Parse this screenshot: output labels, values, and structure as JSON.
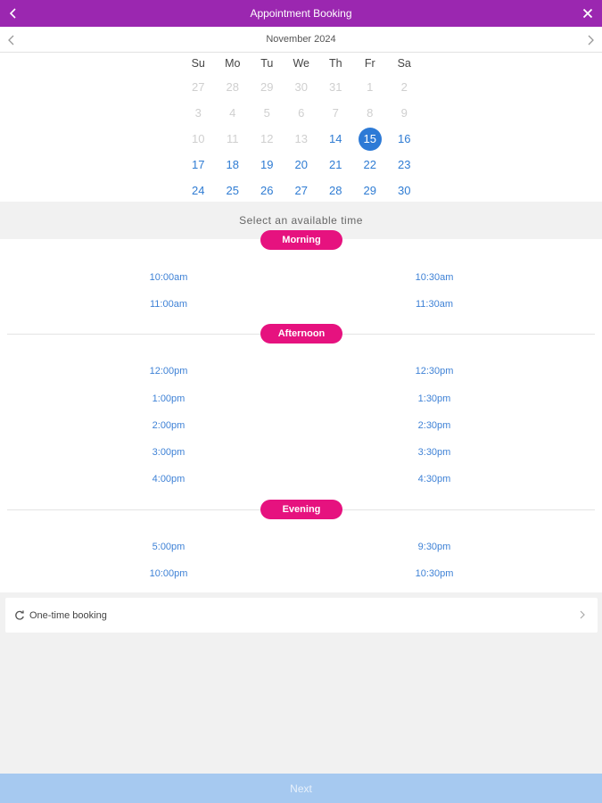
{
  "header": {
    "title": "Appointment Booking",
    "back_icon": "chevron-left-icon",
    "close_icon": "close-icon",
    "color": "#9b27b0"
  },
  "calendar": {
    "month_label": "November 2024",
    "prev_icon": "chevron-left-icon",
    "next_icon": "chevron-right-icon",
    "weekdays": [
      "Su",
      "Mo",
      "Tu",
      "We",
      "Th",
      "Fr",
      "Sa"
    ],
    "weeks": [
      [
        {
          "d": "27",
          "s": "dim"
        },
        {
          "d": "28",
          "s": "dim"
        },
        {
          "d": "29",
          "s": "dim"
        },
        {
          "d": "30",
          "s": "dim"
        },
        {
          "d": "31",
          "s": "dim"
        },
        {
          "d": "1",
          "s": "dim"
        },
        {
          "d": "2",
          "s": "dim"
        }
      ],
      [
        {
          "d": "3",
          "s": "dim"
        },
        {
          "d": "4",
          "s": "dim"
        },
        {
          "d": "5",
          "s": "dim"
        },
        {
          "d": "6",
          "s": "dim"
        },
        {
          "d": "7",
          "s": "dim"
        },
        {
          "d": "8",
          "s": "dim"
        },
        {
          "d": "9",
          "s": "dim"
        }
      ],
      [
        {
          "d": "10",
          "s": "dim"
        },
        {
          "d": "11",
          "s": "dim"
        },
        {
          "d": "12",
          "s": "dim"
        },
        {
          "d": "13",
          "s": "dim"
        },
        {
          "d": "14",
          "s": "avail"
        },
        {
          "d": "15",
          "s": "sel"
        },
        {
          "d": "16",
          "s": "avail"
        }
      ],
      [
        {
          "d": "17",
          "s": "avail"
        },
        {
          "d": "18",
          "s": "avail"
        },
        {
          "d": "19",
          "s": "avail"
        },
        {
          "d": "20",
          "s": "avail"
        },
        {
          "d": "21",
          "s": "avail"
        },
        {
          "d": "22",
          "s": "avail"
        },
        {
          "d": "23",
          "s": "avail"
        }
      ],
      [
        {
          "d": "24",
          "s": "avail"
        },
        {
          "d": "25",
          "s": "avail"
        },
        {
          "d": "26",
          "s": "avail"
        },
        {
          "d": "27",
          "s": "avail"
        },
        {
          "d": "28",
          "s": "avail"
        },
        {
          "d": "29",
          "s": "avail"
        },
        {
          "d": "30",
          "s": "avail"
        }
      ]
    ],
    "selected_color": "#2d7ad6",
    "available_color": "#2f7cd3"
  },
  "time_select": {
    "prompt": "Select an available time",
    "pill_color": "#e6127f",
    "morning": {
      "label": "Morning",
      "left": [
        "10:00am",
        "11:00am"
      ],
      "right": [
        "10:30am",
        "11:30am"
      ]
    },
    "afternoon": {
      "label": "Afternoon",
      "left": [
        "12:00pm",
        "1:00pm",
        "2:00pm",
        "3:00pm",
        "4:00pm"
      ],
      "right": [
        "12:30pm",
        "1:30pm",
        "2:30pm",
        "3:30pm",
        "4:30pm"
      ]
    },
    "evening": {
      "label": "Evening",
      "left": [
        "5:00pm",
        "10:00pm"
      ],
      "right": [
        "9:30pm",
        "10:30pm"
      ]
    }
  },
  "booking_type": {
    "label": "One-time booking",
    "icon": "repeat-icon",
    "chevron_icon": "chevron-right-icon"
  },
  "footer": {
    "next_label": "Next",
    "color": "#a6c9f0"
  }
}
